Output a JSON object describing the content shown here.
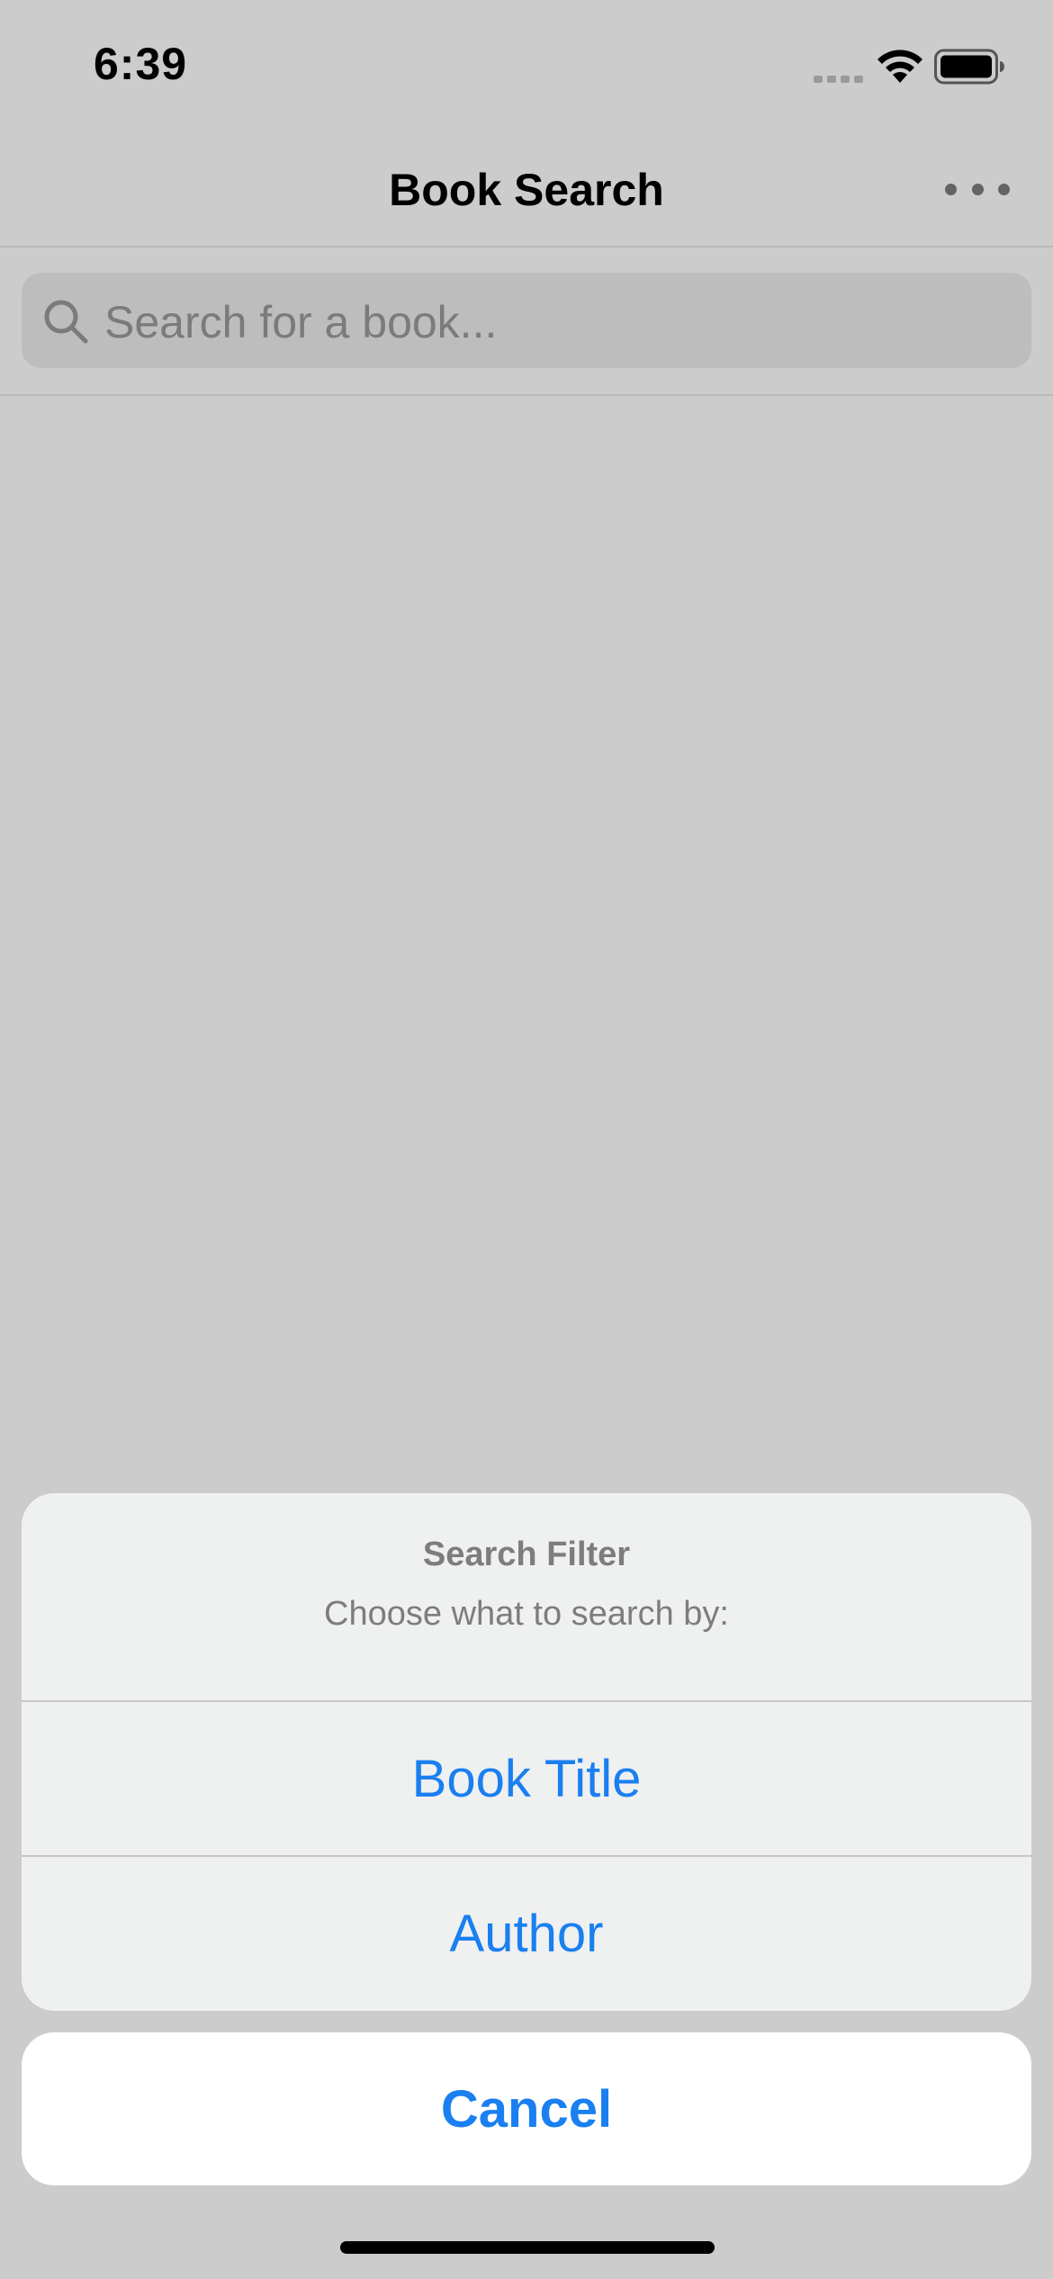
{
  "status_bar": {
    "time": "6:39",
    "icons": [
      "cellular-signal-icon",
      "wifi-icon",
      "battery-icon"
    ]
  },
  "nav_bar": {
    "title": "Book Search",
    "more_icon": "ellipsis-icon"
  },
  "search": {
    "icon": "search-icon",
    "placeholder": "Search for a book..."
  },
  "action_sheet": {
    "title": "Search Filter",
    "message": "Choose what to search by:",
    "options": [
      {
        "label": "Book Title"
      },
      {
        "label": "Author"
      }
    ],
    "cancel_label": "Cancel"
  },
  "colors": {
    "accent": "#1a7ff0",
    "dimmed_background": "#cccccc",
    "sheet_background": "#eff0f0"
  }
}
